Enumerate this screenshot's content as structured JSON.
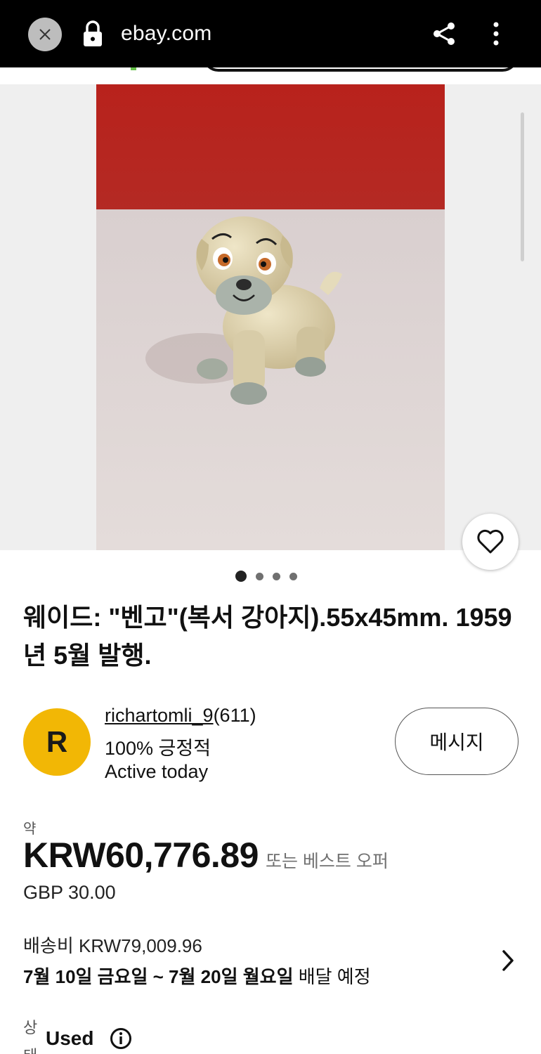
{
  "browser": {
    "url": "ebay.com",
    "close_icon": "close-icon",
    "lock_icon": "lock-icon",
    "share_icon": "share-icon",
    "menu_icon": "more-vertical-icon"
  },
  "listing": {
    "image_count": 4,
    "active_image_index": 0,
    "favorite_icon": "heart-icon",
    "title": "웨이드: \"벤고\"(복서 강아지).55x45mm. 1959년 5월 발행."
  },
  "seller": {
    "avatar_initial": "R",
    "avatar_color": "#f2b705",
    "username": "richartomli_9",
    "feedback_count": "(611)",
    "positive_feedback": "100% 긍정적",
    "activity": "Active today",
    "message_button": "메시지"
  },
  "price": {
    "approx_label": "약",
    "amount": "KRW60,776.89",
    "best_offer": "또는 베스트 오퍼",
    "original": "GBP 30.00"
  },
  "shipping": {
    "cost": "배송비 KRW79,009.96",
    "delivery_dates": "7월 10일 금요일 ~ 7월 20일 월요일",
    "delivery_suffix": " 배달 예정",
    "chevron_icon": "chevron-right-icon"
  },
  "condition": {
    "label": "상태",
    "value": "Used",
    "info_icon": "info-icon"
  }
}
